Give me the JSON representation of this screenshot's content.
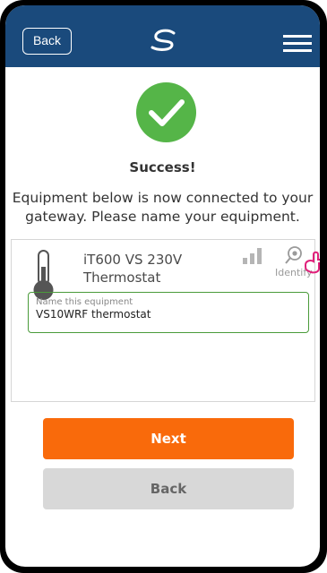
{
  "header": {
    "back_label": "Back",
    "logo_icon": "salus-logo-icon",
    "menu_icon": "hamburger-menu-icon",
    "background_color": "#1a4a7c"
  },
  "status": {
    "icon": "check-circle-icon",
    "title": "Success!",
    "description": "Equipment below is now connected to your gateway. Please name your equipment."
  },
  "equipment": {
    "icon": "thermometer-icon",
    "name": "iT600 VS 230V Thermostat",
    "signal_icon": "signal-strength-icon",
    "identify_icon": "identify-eye-icon",
    "identify_label": "Identify",
    "field_label": "Name this equipment",
    "field_value": "VS10WRF thermostat"
  },
  "actions": {
    "next_label": "Next",
    "back_label": "Back",
    "next_color": "#f96a0b"
  }
}
